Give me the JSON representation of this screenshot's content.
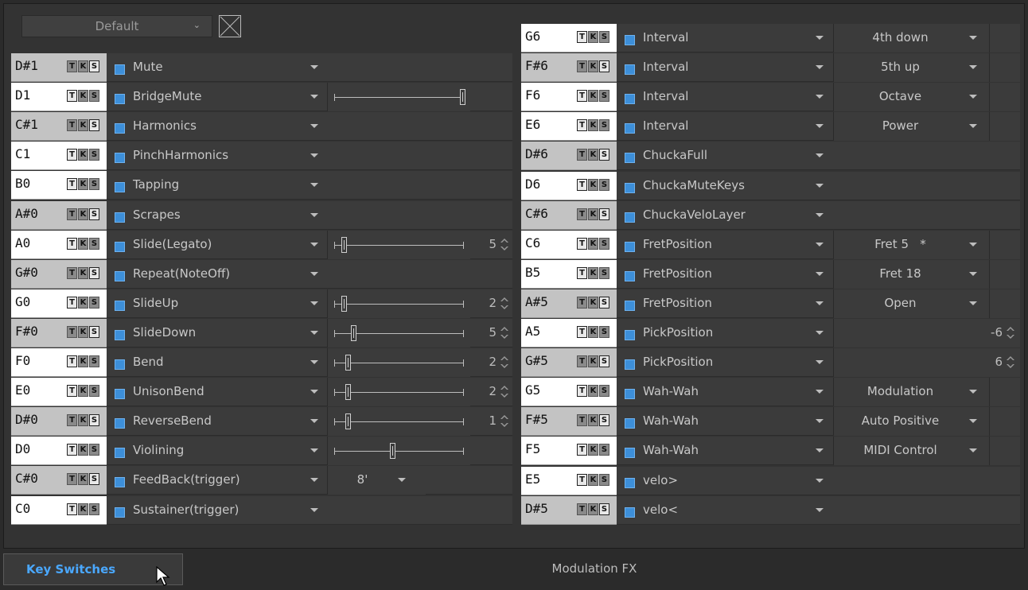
{
  "preset": {
    "name": "Default",
    "chevron": "chevron-down-icon",
    "clear_icon": "close-box-icon"
  },
  "footer": {
    "active_tab": "Key Switches",
    "center_label": "Modulation FX"
  },
  "tks_labels": [
    "T",
    "K",
    "S"
  ],
  "colors": {
    "accent": "#3d8fd9",
    "tab_text": "#4aa8ff",
    "background": "#333333"
  },
  "left_rows": [
    {
      "note": "D#1",
      "sharp": true,
      "art": "Mute",
      "ctrl": "none"
    },
    {
      "note": "D1",
      "sharp": false,
      "art": "BridgeMute",
      "ctrl": "slider",
      "pos": 1.0
    },
    {
      "note": "C#1",
      "sharp": true,
      "art": "Harmonics",
      "ctrl": "none"
    },
    {
      "note": "C1",
      "sharp": false,
      "art": "PinchHarmonics",
      "ctrl": "none"
    },
    {
      "note": "B0",
      "sharp": false,
      "art": "Tapping",
      "ctrl": "none"
    },
    {
      "note": "A#0",
      "sharp": true,
      "art": "Scrapes",
      "ctrl": "none"
    },
    {
      "note": "A0",
      "sharp": false,
      "art": "Slide(Legato)",
      "ctrl": "slider_spin",
      "value": "5",
      "pos": 0.06
    },
    {
      "note": "G#0",
      "sharp": true,
      "art": "Repeat(NoteOff)",
      "ctrl": "none"
    },
    {
      "note": "G0",
      "sharp": false,
      "art": "SlideUp",
      "ctrl": "slider_spin",
      "value": "2",
      "pos": 0.06
    },
    {
      "note": "F#0",
      "sharp": true,
      "art": "SlideDown",
      "ctrl": "slider_spin",
      "value": "5",
      "pos": 0.13
    },
    {
      "note": "F0",
      "sharp": false,
      "art": "Bend",
      "ctrl": "slider_spin",
      "value": "2",
      "pos": 0.09
    },
    {
      "note": "E0",
      "sharp": false,
      "art": "UnisonBend",
      "ctrl": "slider_spin",
      "value": "2",
      "pos": 0.09
    },
    {
      "note": "D#0",
      "sharp": true,
      "art": "ReverseBend",
      "ctrl": "slider_spin",
      "value": "1",
      "pos": 0.09
    },
    {
      "note": "D0",
      "sharp": false,
      "art": "Violining",
      "ctrl": "slider",
      "pos": 0.44
    },
    {
      "note": "C#0",
      "sharp": true,
      "art": "FeedBack(trigger)",
      "ctrl": "dropdown",
      "value": "8'"
    },
    {
      "note": "C0",
      "sharp": false,
      "art": "Sustainer(trigger)",
      "ctrl": "none"
    }
  ],
  "right_rows": [
    {
      "note": "G6",
      "sharp": false,
      "art": "Interval",
      "ctrl": "dropdown",
      "value": "4th down"
    },
    {
      "note": "F#6",
      "sharp": true,
      "art": "Interval",
      "ctrl": "dropdown",
      "value": "5th up"
    },
    {
      "note": "F6",
      "sharp": false,
      "art": "Interval",
      "ctrl": "dropdown",
      "value": "Octave"
    },
    {
      "note": "E6",
      "sharp": false,
      "art": "Interval",
      "ctrl": "dropdown",
      "value": "Power"
    },
    {
      "note": "D#6",
      "sharp": true,
      "art": "ChuckaFull",
      "ctrl": "none"
    },
    {
      "note": "D6",
      "sharp": false,
      "art": "ChuckaMuteKeys",
      "ctrl": "none"
    },
    {
      "note": "C#6",
      "sharp": true,
      "art": "ChuckaVeloLayer",
      "ctrl": "none"
    },
    {
      "note": "C6",
      "sharp": false,
      "art": "FretPosition",
      "ctrl": "dropdown",
      "value": "Fret 5   *"
    },
    {
      "note": "B5",
      "sharp": false,
      "art": "FretPosition",
      "ctrl": "dropdown",
      "value": "Fret 18"
    },
    {
      "note": "A#5",
      "sharp": true,
      "art": "FretPosition",
      "ctrl": "dropdown",
      "value": "Open"
    },
    {
      "note": "A5",
      "sharp": false,
      "art": "PickPosition",
      "ctrl": "spin",
      "value": "-6"
    },
    {
      "note": "G#5",
      "sharp": true,
      "art": "PickPosition",
      "ctrl": "spin",
      "value": "6"
    },
    {
      "note": "G5",
      "sharp": false,
      "art": "Wah-Wah",
      "ctrl": "dropdown",
      "value": "Modulation"
    },
    {
      "note": "F#5",
      "sharp": true,
      "art": "Wah-Wah",
      "ctrl": "dropdown",
      "value": "Auto Positive"
    },
    {
      "note": "F5",
      "sharp": false,
      "art": "Wah-Wah",
      "ctrl": "dropdown",
      "value": "MIDI Control"
    },
    {
      "note": "E5",
      "sharp": false,
      "art": "velo>",
      "ctrl": "none"
    },
    {
      "note": "D#5",
      "sharp": true,
      "art": "velo<",
      "ctrl": "none"
    }
  ]
}
